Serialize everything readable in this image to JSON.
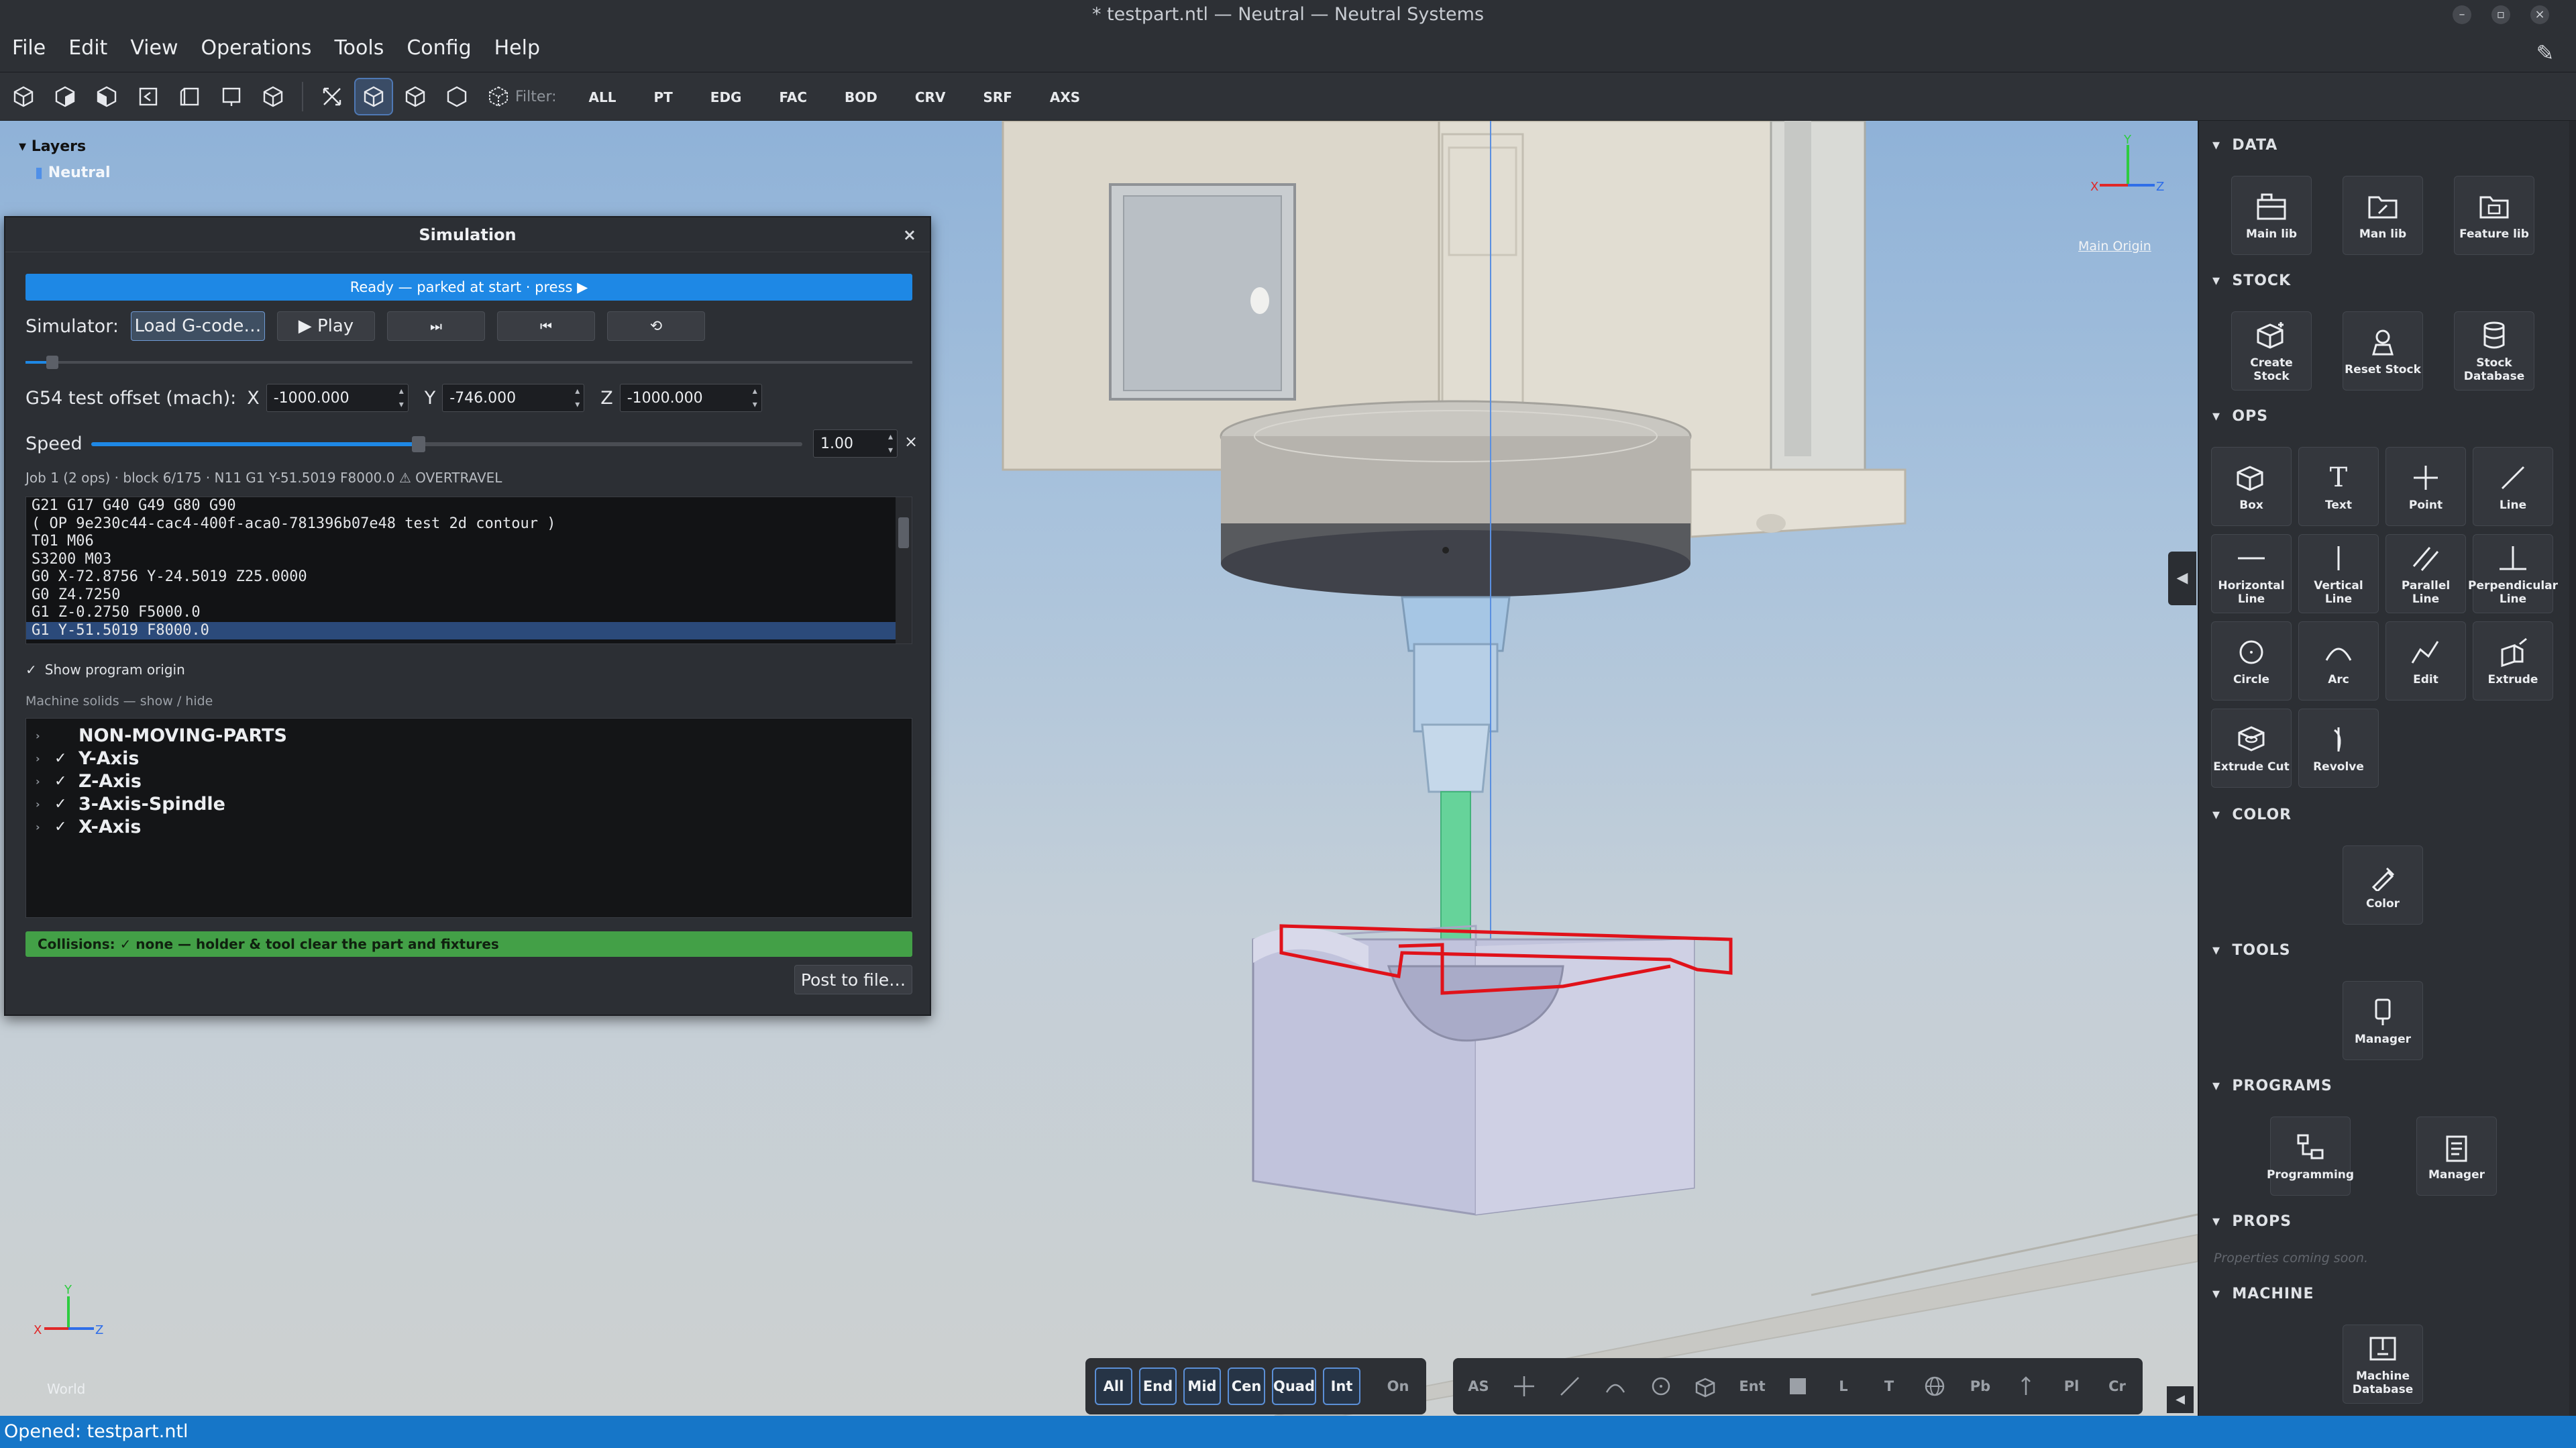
{
  "window": {
    "title": "* testpart.ntl — Neutral — Neutral Systems"
  },
  "menu": [
    "File",
    "Edit",
    "View",
    "Operations",
    "Tools",
    "Config",
    "Help"
  ],
  "toolbar": {
    "filter_label": "Filter:",
    "filters": [
      "ALL",
      "PT",
      "EDG",
      "FAC",
      "BOD",
      "CRV",
      "SRF",
      "AXS"
    ]
  },
  "layers": {
    "header": "Layers",
    "items": [
      "Neutral"
    ]
  },
  "viewport": {
    "origin_label": "Main Origin",
    "world_label": "World"
  },
  "simulation": {
    "title": "Simulation",
    "status": "Ready — parked at start · press ▶",
    "simulator_label": "Simulator:",
    "load_button": "Load G-code…",
    "play_button": "▶ Play",
    "step_icon": "⏭",
    "rewind_icon": "⏮",
    "reset_icon": "⟲",
    "progress_fraction": 0.03,
    "g54_label": "G54 test offset (mach):",
    "x_label": "X",
    "x_value": "-1000.000",
    "y_label": "Y",
    "y_value": "-746.000",
    "z_label": "Z",
    "z_value": "-1000.000",
    "speed_label": "Speed",
    "speed_fraction": 0.46,
    "speed_value": "1.00",
    "speed_clear": "×",
    "job_info": "Job 1 (2 ops) · block 6/175 · N11 G1 Y-51.5019 F8000.0 ⚠ OVERTRAVEL",
    "code_lines": [
      "G21 G17 G40 G49 G80 G90",
      "( OP 9e230c44-cac4-400f-aca0-781396b07e48 test 2d contour )",
      "T01 M06",
      "S3200 M03",
      "G0 X-72.8756 Y-24.5019 Z25.0000",
      "G0 Z4.7250",
      "G1 Z-0.2750 F5000.0",
      "G1 Y-51.5019 F8000.0"
    ],
    "show_origin_check": "✓",
    "show_origin_label": "Show program origin",
    "solids_label": "Machine solids — show / hide",
    "solids": [
      {
        "arrow": "›",
        "check": "",
        "name": "NON-MOVING-PARTS"
      },
      {
        "arrow": "›",
        "check": "✓",
        "name": "Y-Axis"
      },
      {
        "arrow": "›",
        "check": "✓",
        "name": "Z-Axis"
      },
      {
        "arrow": "›",
        "check": "✓",
        "name": "3-Axis-Spindle"
      },
      {
        "arrow": "›",
        "check": "✓",
        "name": "X-Axis"
      }
    ],
    "collisions": "Collisions: ✓ none — holder & tool clear the part and fixtures",
    "post_button": "Post to file…"
  },
  "panel": {
    "sections": {
      "data": "DATA",
      "stock": "STOCK",
      "ops": "OPS",
      "color": "COLOR",
      "tools": "TOOLS",
      "programs": "PROGRAMS",
      "props": "PROPS",
      "machine": "MACHINE"
    },
    "data_tools": [
      "Main lib",
      "Man lib",
      "Feature lib"
    ],
    "stock_tools": [
      "Create Stock",
      "Reset Stock",
      "Stock Database"
    ],
    "ops_tools": [
      "Box",
      "Text",
      "Point",
      "Line",
      "Horizontal Line",
      "Vertical Line",
      "Parallel Line",
      "Perpendicular Line",
      "Circle",
      "Arc",
      "Edit",
      "Extrude",
      "Extrude Cut",
      "Revolve"
    ],
    "color_tools": [
      "Color"
    ],
    "tools_tools": [
      "Manager"
    ],
    "programs_tools": [
      "Programming",
      "Manager"
    ],
    "props_placeholder": "Properties coming soon.",
    "machine_tools": [
      "Machine Database"
    ]
  },
  "snap": {
    "modes": [
      "All",
      "End",
      "Mid",
      "Cen",
      "Quad",
      "Int"
    ],
    "on_label": "On",
    "tools": [
      "AS",
      "Ent",
      "L",
      "T",
      "Pb",
      "Pl",
      "Cr"
    ]
  },
  "statusbar": {
    "text": "Opened: testpart.ntl"
  }
}
